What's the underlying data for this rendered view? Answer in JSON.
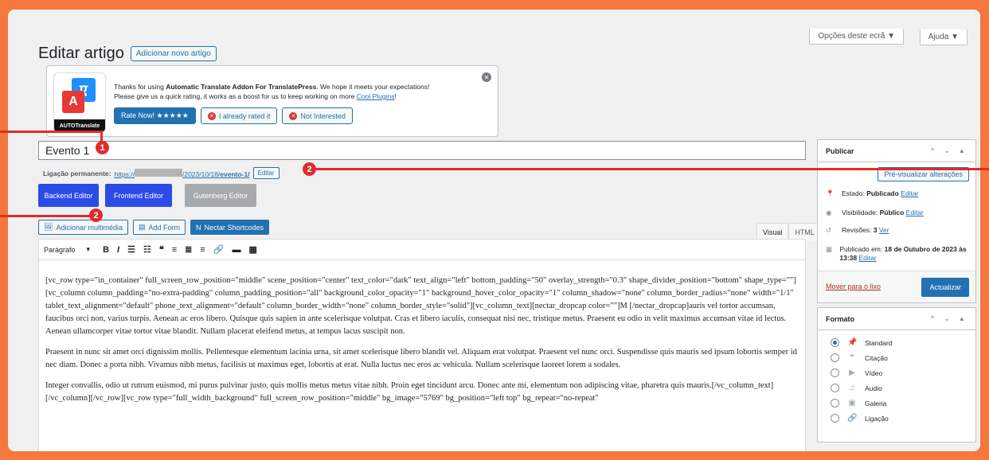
{
  "header": {
    "title": "Editar artigo",
    "add_new": "Adicionar novo artigo"
  },
  "screen_options": {
    "options_label": "Opções deste ecrã ▼",
    "help_label": "Ajuda ▼"
  },
  "notice": {
    "logo_blue": "ए",
    "logo_red": "A",
    "logo_bar": "AUTOTranslate",
    "text_prefix": "Thanks for using ",
    "plugin_name": "Automatic Translate Addon For TranslatePress",
    "text_suffix": ". We hope it meets your expectations!",
    "line2": "Please give us a quick rating, it works as a boost for us to keep working on more ",
    "link": "Cool Plugins",
    "line2_end": "!",
    "rate_now": "Rate Now! ★★★★★",
    "already_rated": "I already rated it",
    "not_interested": "Not Interested",
    "close": "✕"
  },
  "post": {
    "title": "Evento 1",
    "permalink_label": "Ligação permanente:",
    "permalink_start": "https://",
    "permalink_path": "/2023/10/18/",
    "permalink_slug": "evento-1/",
    "edit": "Editar"
  },
  "builders": {
    "backend": "Backend Editor",
    "frontend": "Frontend Editor",
    "gutenberg": "Gutenberg Editor"
  },
  "media": {
    "add_media": "Adicionar multimédia",
    "add_form": "Add Form",
    "nectar": "Nectar Shortcodes"
  },
  "editor_tabs": {
    "visual": "Visual",
    "html": "HTML"
  },
  "toolbar": {
    "format": "Parágrafo",
    "bold": "B",
    "italic": "I"
  },
  "content": {
    "p1": "[vc_row type=\"in_container\" full_screen_row_position=\"middle\" scene_position=\"center\" text_color=\"dark\" text_align=\"left\" bottom_padding=\"50\" overlay_strength=\"0.3\" shape_divider_position=\"bottom\" shape_type=\"\"][vc_column column_padding=\"no-extra-padding\" column_padding_position=\"all\" background_color_opacity=\"1\" background_hover_color_opacity=\"1\" column_shadow=\"none\" column_border_radius=\"none\" width=\"1/1\" tablet_text_alignment=\"default\" phone_text_alignment=\"default\" column_border_width=\"none\" column_border_style=\"solid\"][vc_column_text][nectar_dropcap color=\"\"]M [/nectar_dropcap]auris vel tortor accumsan, faucibus orci non, varius turpis. Aenean ac eros libero. Quisque quis sapien in ante scelerisque volutpat. Cras et libero iaculis, consequat nisi nec, tristique metus. Praesent eu odio in velit maximus accumsan vitae id lectus. Aenean ullamcorper vitae tortor vitae blandit. Nullam placerat eleifend metus, at tempus lacus suscipit non.",
    "p2": "Praesent in nunc sit amet orci dignissim mollis. Pellentesque elementum lacinia urna, sit amet scelerisque libero blandit vel. Aliquam erat volutpat. Praesent vel nunc orci. Suspendisse quis mauris sed ipsum lobortis semper id nec diam. Donec a porta nibh. Vivamus nibh metus, facilisis ut maximus eget, lobortis at erat. Nulla luctus nec eros ac vehicula. Nullam scelerisque laoreet lorem a sodales.",
    "p3": "Integer convallis, odio ut rutrum euismod, mi purus pulvinar justo, quis mollis metus metus vitae nibh. Proin eget tincidunt arcu. Donec ante mi, elementum non adipiscing vitae, pharetra quis mauris.[/vc_column_text][/vc_column][/vc_row][vc_row type=\"full_width_background\" full_screen_row_position=\"middle\" bg_image=\"5769\" bg_position=\"left top\" bg_repeat=\"no-repeat\""
  },
  "publish": {
    "title": "Publicar",
    "preview": "Pré-visualizar alterações",
    "status_label": "Estado: ",
    "status_value": "Publicado",
    "status_edit": "Editar",
    "visibility_label": "Visibilidade: ",
    "visibility_value": "Público",
    "visibility_edit": "Editar",
    "revisions_label": "Revisões: ",
    "revisions_value": "3",
    "revisions_link": "Ver",
    "published_label": "Publicado em: ",
    "published_value": "18 de Outubro de 2023 às 13:38",
    "published_edit": "Editar",
    "trash": "Mover para o lixo",
    "update": "Actualizar"
  },
  "format_box": {
    "title": "Formato",
    "options": [
      "Standard",
      "Citação",
      "Vídeo",
      "Audio",
      "Galeria",
      "Ligação"
    ],
    "selected": "Standard"
  },
  "callouts": [
    "1",
    "2",
    "2"
  ],
  "colors": {
    "frame_bg": "#f4773e",
    "accent": "#2271b1",
    "callout": "#e12b2b",
    "builder_blue": "#2c4be8"
  }
}
